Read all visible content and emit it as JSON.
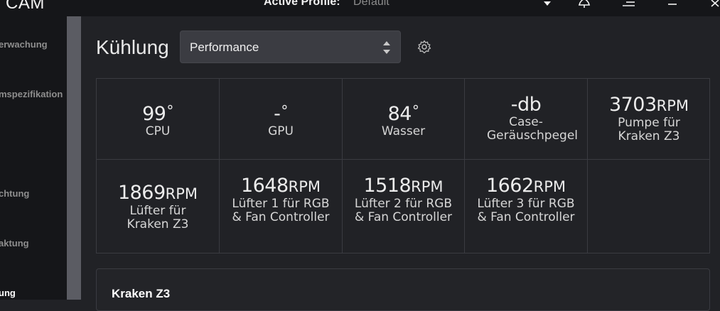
{
  "app": {
    "name": "CAM"
  },
  "header": {
    "active_profile_label": "Active Profile:",
    "active_profile_value": "Default",
    "icons": [
      "chevron-down-icon",
      "bell-icon",
      "menu-icon",
      "minimize-icon",
      "close-icon"
    ]
  },
  "sidebar": {
    "items": [
      {
        "label": "erwachung",
        "active": false
      },
      {
        "label": "mspezifikation",
        "active": false
      },
      {
        "label": "",
        "active": false
      },
      {
        "label": "chtung",
        "active": false
      },
      {
        "label": "aktung",
        "active": false
      },
      {
        "label": "ung",
        "active": true
      }
    ]
  },
  "page": {
    "title": "Kühlung",
    "profile_select": {
      "value": "Performance"
    }
  },
  "stats": {
    "row1": [
      {
        "value": "99",
        "unit": "°",
        "label": "CPU"
      },
      {
        "value": "-",
        "unit": "°",
        "label": "GPU"
      },
      {
        "value": "84",
        "unit": "°",
        "label": "Wasser"
      },
      {
        "value": "-db",
        "unit": "",
        "label": "Case-Geräuschpegel"
      },
      {
        "value": "3703",
        "unit": "RPM",
        "label": "Pumpe für Kraken Z3"
      }
    ],
    "row2": [
      {
        "value": "1869",
        "unit": "RPM",
        "label": "Lüfter für Kraken Z3"
      },
      {
        "value": "1648",
        "unit": "RPM",
        "label": "Lüfter 1 für RGB & Fan Controller"
      },
      {
        "value": "1518",
        "unit": "RPM",
        "label": "Lüfter 2 für RGB & Fan Controller"
      },
      {
        "value": "1662",
        "unit": "RPM",
        "label": "Lüfter 3 für RGB & Fan Controller"
      }
    ]
  },
  "card": {
    "title": "Kraken Z3"
  }
}
